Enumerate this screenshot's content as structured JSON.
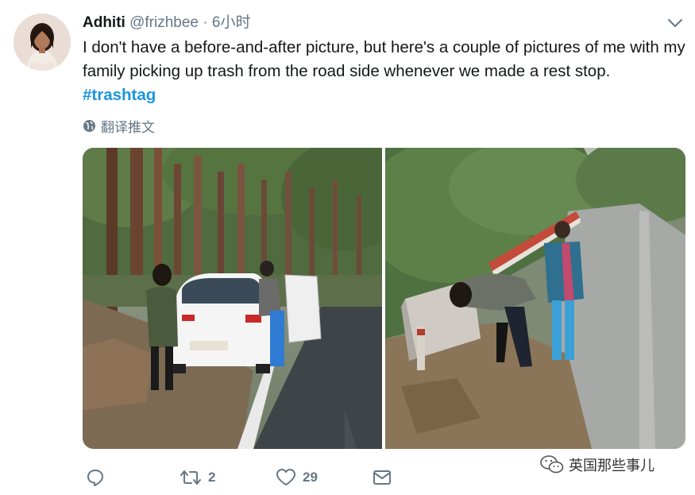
{
  "tweet": {
    "author_name": "Adhiti",
    "author_handle": "@frizhbee",
    "separator": "·",
    "timestamp": "6小时",
    "text": "I don't have a before-and-after picture, but here's a couple of pictures of me with my family picking up trash from the road side whenever we made a rest stop.",
    "hashtag": "#trashtag",
    "translate_label": "翻译推文"
  },
  "actions": {
    "reply_count": "",
    "retweet_count": "2",
    "like_count": "29"
  },
  "watermark": {
    "text": "英国那些事儿"
  },
  "colors": {
    "link": "#1b95e0",
    "secondary_text": "#657786",
    "primary_text": "#14171a"
  },
  "icons": {
    "menu": "chevron-down-icon",
    "translate": "globe-icon",
    "reply": "reply-icon",
    "retweet": "retweet-icon",
    "like": "heart-icon",
    "share": "share-icon",
    "watermark": "wechat-icon"
  }
}
